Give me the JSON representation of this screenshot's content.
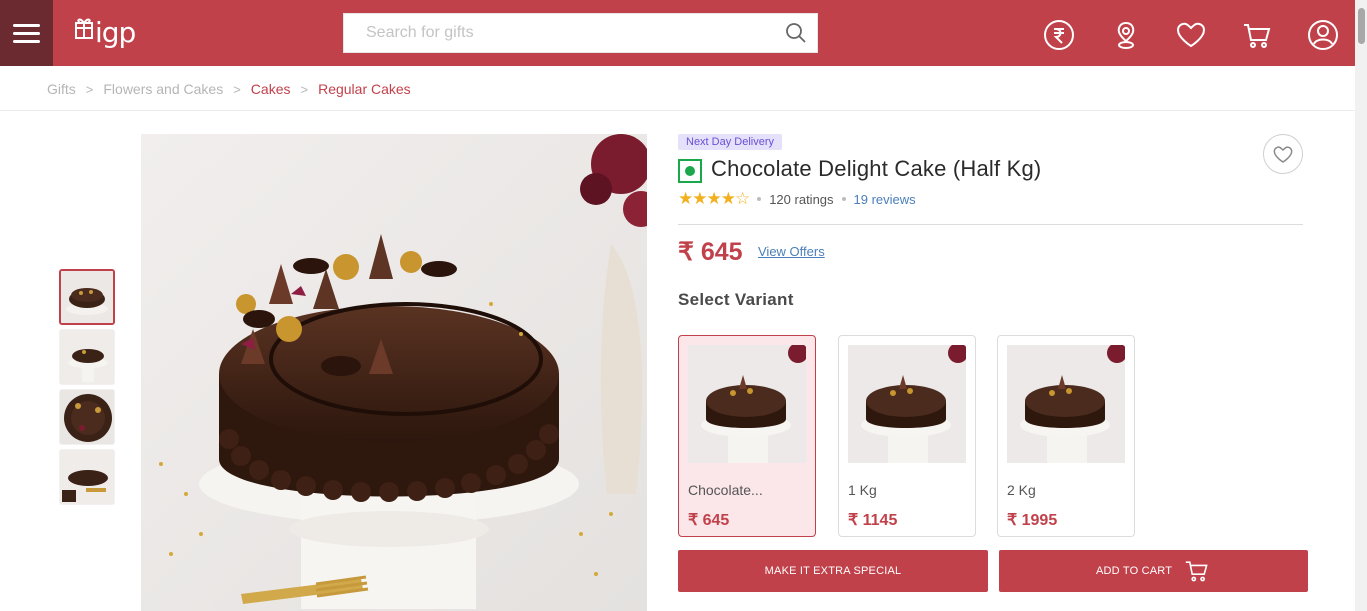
{
  "header": {
    "logo_text": "igp",
    "search_placeholder": "Search for gifts",
    "icons": [
      "rupee-currency-icon",
      "location-icon",
      "heart-icon",
      "cart-icon",
      "user-icon"
    ],
    "brand_color": "#c1414b"
  },
  "breadcrumb": {
    "items": [
      {
        "label": "Gifts",
        "active": false
      },
      {
        "label": "Flowers and Cakes",
        "active": false
      },
      {
        "label": "Cakes",
        "active": true
      },
      {
        "label": "Regular Cakes",
        "active": true
      }
    ]
  },
  "product": {
    "badge": "Next Day Delivery",
    "title": "Chocolate Delight Cake (Half Kg)",
    "stars": "★★★★☆",
    "rating_value": 4.5,
    "ratings_count": "120 ratings",
    "reviews_count": "19 reviews",
    "price": "₹ 645",
    "view_offers": "View Offers",
    "select_variant": "Select Variant",
    "variants": [
      {
        "name": "Chocolate...",
        "price": "₹ 645",
        "selected": true
      },
      {
        "name": "1 Kg",
        "price": "₹ 1145",
        "selected": false
      },
      {
        "name": "2 Kg",
        "price": "₹ 1995",
        "selected": false
      }
    ],
    "thumbnails": 4,
    "selected_thumbnail": 1
  },
  "actions": {
    "extra_special": "MAKE IT EXTRA SPECIAL",
    "add_to_cart": "ADD TO CART"
  }
}
